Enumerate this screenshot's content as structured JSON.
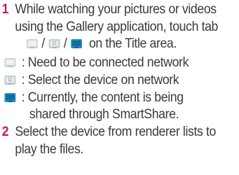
{
  "steps": [
    {
      "number": "1",
      "line1": "While watching your pictures or videos",
      "line2": "using the Gallery application, touch tab",
      "line3_sep1": "/",
      "line3_sep2": "/",
      "line3_text": "on the Title area."
    },
    {
      "number": "2",
      "line1": "Select the device from renderer lists to",
      "line2": "play the files."
    }
  ],
  "icon_legend": [
    {
      "icon": "network-disconnected-icon",
      "text": ": Need to be connected network"
    },
    {
      "icon": "network-select-icon",
      "text": ": Select the device on network"
    },
    {
      "icon": "smartshare-sharing-icon",
      "text_line1": ": Currently, the content is being",
      "text_line2": "shared through SmartShare."
    }
  ],
  "colors": {
    "step_number": "#c8165a",
    "body_text": "#3a3a3a",
    "icon_active": "#1a8fc4",
    "icon_inactive": "#cfd3d6"
  }
}
